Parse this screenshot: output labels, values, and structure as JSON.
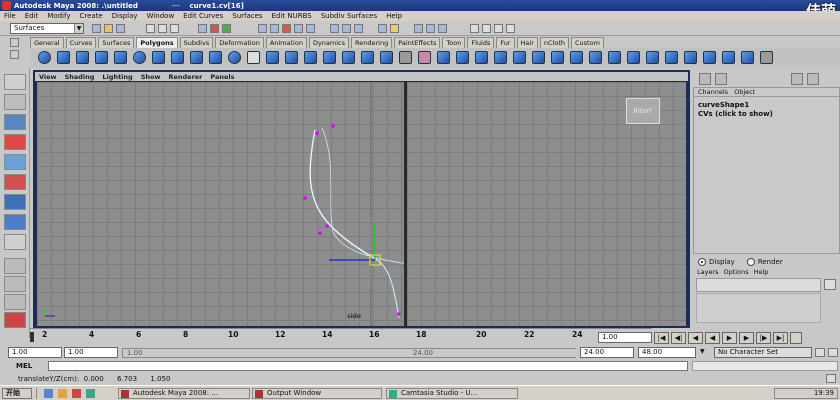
{
  "window": {
    "title": "Autodesk Maya 2008: .\\untitled",
    "title_extra": "curve1.cv[16]",
    "title_sep": "---"
  },
  "watermark": "佳萌",
  "menubar": [
    "File",
    "Edit",
    "Modify",
    "Create",
    "Display",
    "Window",
    "Edit Curves",
    "Surfaces",
    "Edit NURBS",
    "Subdiv Surfaces",
    "Help"
  ],
  "status_line": {
    "mode": "Surfaces"
  },
  "shelf": {
    "tabs": [
      "General",
      "Curves",
      "Surfaces",
      "Polygons",
      "Subdivs",
      "Deformation",
      "Animation",
      "Dynamics",
      "Rendering",
      "PaintEffects",
      "Toon",
      "Fluids",
      "Fur",
      "Hair",
      "nCloth",
      "Custom"
    ],
    "active_tab": "Polygons"
  },
  "viewport": {
    "panel_menu": [
      "View",
      "Shading",
      "Lighting",
      "Show",
      "Renderer",
      "Panels"
    ],
    "view_cube_label": "RIGHT",
    "camera_label": "side"
  },
  "channel_box": {
    "header": [
      "Channels",
      "Object"
    ],
    "shape_name": "curveShape1",
    "cvs_label": "CVs (click to show)"
  },
  "layer_editor": {
    "display_label": "Display",
    "render_label": "Render",
    "menu": [
      "Layers",
      "Options",
      "Help"
    ]
  },
  "time_slider": {
    "ticks": [
      "2",
      "4",
      "6",
      "8",
      "10",
      "12",
      "14",
      "16",
      "18",
      "20",
      "22",
      "24"
    ],
    "current_frame": "1.00"
  },
  "range_slider": {
    "start": "1.00",
    "playback_start": "1.00",
    "range_start_label": "1.00",
    "range_end_label": "24.00",
    "playback_end": "24.00",
    "end": "48.00",
    "character_set": "No Character Set"
  },
  "command_line": {
    "label": "MEL"
  },
  "help_line": {
    "text": "translateY/Z(cm):  0.000      6.703      1.050"
  },
  "taskbar": {
    "start_label": "开始",
    "buttons": [
      "Autodesk Maya 2008: ...",
      "Output Window",
      "Camtasia Studio - U..."
    ],
    "clock": "19:39"
  }
}
